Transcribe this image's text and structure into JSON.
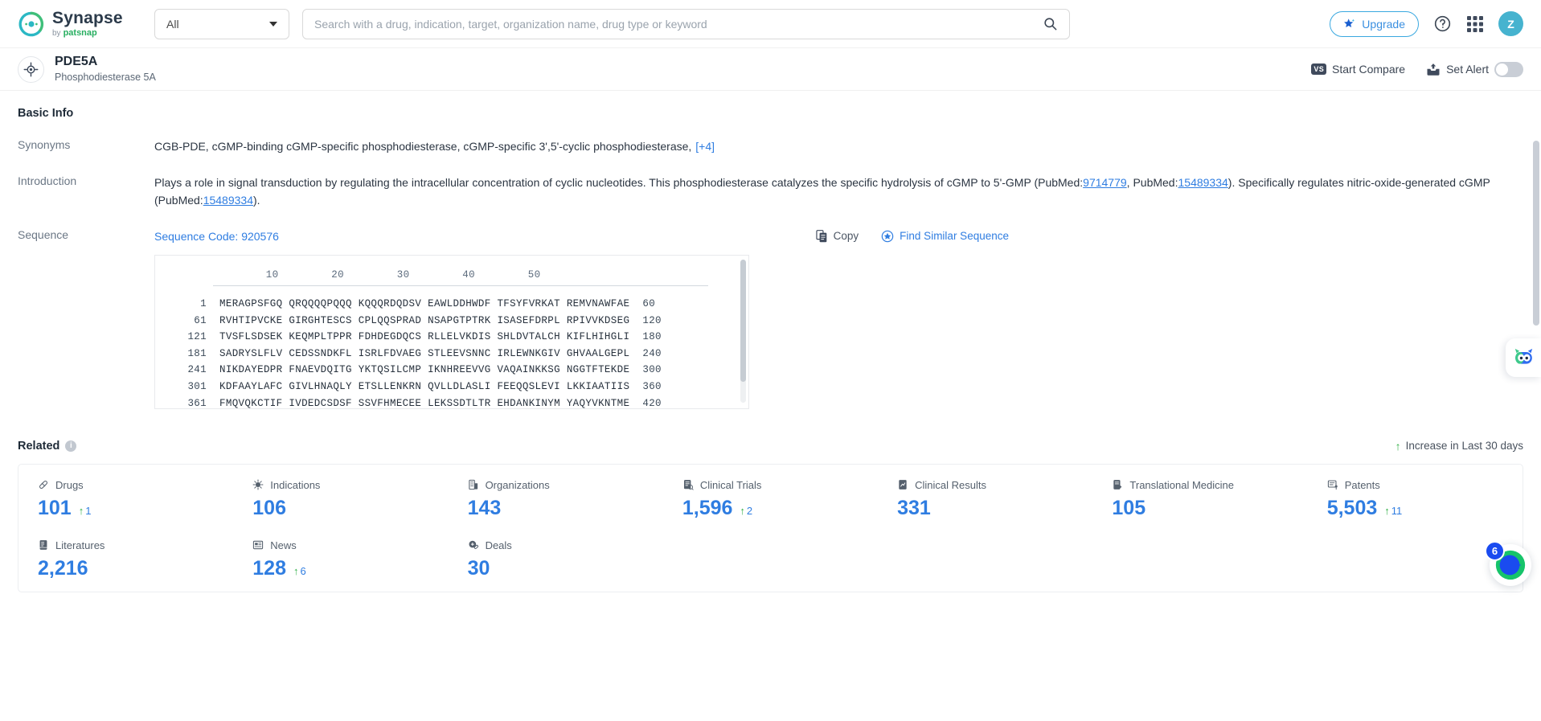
{
  "header": {
    "logo_name": "Synapse",
    "logo_by": "by",
    "logo_brand": "patsnap",
    "scope_value": "All",
    "search_placeholder": "Search with a drug, indication, target, organization name, drug type or keyword",
    "search_value": "",
    "upgrade_label": "Upgrade",
    "avatar_initial": "Z"
  },
  "title_bar": {
    "name": "PDE5A",
    "full_name": "Phosphodiesterase 5A",
    "start_compare_label": "Start Compare",
    "compare_badge": "VS",
    "set_alert_label": "Set Alert",
    "alert_enabled": false
  },
  "basic_info": {
    "heading": "Basic Info",
    "synonyms_label": "Synonyms",
    "synonyms_text": "CGB-PDE,  cGMP-binding cGMP-specific phosphodiesterase,  cGMP-specific 3',5'-cyclic phosphodiesterase,",
    "synonyms_more": "[+4]",
    "introduction_label": "Introduction",
    "intro_part1": "Plays a role in signal transduction by regulating the intracellular concentration of cyclic nucleotides. This phosphodiesterase catalyzes the specific hydrolysis of cGMP to 5'-GMP (PubMed:",
    "intro_link1": "9714779",
    "intro_part2": ", PubMed:",
    "intro_link2": "15489334",
    "intro_part3": "). Specifically regulates nitric-oxide-generated cGMP (PubMed:",
    "intro_link3": "15489334",
    "intro_part4": ")."
  },
  "sequence": {
    "label": "Sequence",
    "code_label": "Sequence Code: 920576",
    "copy_label": "Copy",
    "find_similar_label": "Find Similar Sequence",
    "ruler": [
      "10",
      "20",
      "30",
      "40",
      "50"
    ],
    "rows": [
      {
        "start": "1",
        "chunks": "MERAGPSFGQ QRQQQQPQQQ KQQQRDQDSV EAWLDDHWDF TFSYFVRKAT REMVNAWFAE",
        "end": "60"
      },
      {
        "start": "61",
        "chunks": "RVHTIPVCKE GIRGHTESCS CPLQQSPRAD NSAPGTPTRK ISASEFDRPL RPIVVKDSEG",
        "end": "120"
      },
      {
        "start": "121",
        "chunks": "TVSFLSDSEK KEQMPLTPPR FDHDEGDQCS RLLELVKDIS SHLDVTALCH KIFLHIHGLI",
        "end": "180"
      },
      {
        "start": "181",
        "chunks": "SADRYSLFLV CEDSSNDKFL ISRLFDVAEG STLEEVSNNC IRLEWNKGIV GHVAALGEPL",
        "end": "240"
      },
      {
        "start": "241",
        "chunks": "NIKDAYEDPR FNAEVDQITG YKTQSILCMP IKNHREEVVG VAQAINKKSG NGGTFTEKDE",
        "end": "300"
      },
      {
        "start": "301",
        "chunks": "KDFAAYLAFC GIVLHNAQLY ETSLLENKRN QVLLDLASLI FEEQQSLEVI LKKIAATIIS",
        "end": "360"
      },
      {
        "start": "361",
        "chunks": "FMQVQKCTIF IVDEDCSDSF SSVFHMECEE LEKSSDTLTR EHDANKINYM YAQYVKNTME",
        "end": "420"
      }
    ]
  },
  "related": {
    "heading": "Related",
    "info_glyph": "i",
    "increase_note": "Increase in Last 30 days",
    "cards": [
      {
        "icon": "pill-icon",
        "label": "Drugs",
        "value": "101",
        "delta": "1"
      },
      {
        "icon": "virus-icon",
        "label": "Indications",
        "value": "106",
        "delta": ""
      },
      {
        "icon": "building-icon",
        "label": "Organizations",
        "value": "143",
        "delta": ""
      },
      {
        "icon": "clinical-trial-icon",
        "label": "Clinical Trials",
        "value": "1,596",
        "delta": "2"
      },
      {
        "icon": "clinical-result-icon",
        "label": "Clinical Results",
        "value": "331",
        "delta": ""
      },
      {
        "icon": "translational-medicine-icon",
        "label": "Translational Medicine",
        "value": "105",
        "delta": ""
      },
      {
        "icon": "patent-icon",
        "label": "Patents",
        "value": "5,503",
        "delta": "11"
      },
      {
        "icon": "literature-icon",
        "label": "Literatures",
        "value": "2,216",
        "delta": ""
      },
      {
        "icon": "news-icon",
        "label": "News",
        "value": "128",
        "delta": "6"
      },
      {
        "icon": "deal-icon",
        "label": "Deals",
        "value": "30",
        "delta": ""
      }
    ]
  },
  "floating": {
    "chat_badge": "6"
  },
  "colors": {
    "accent_blue": "#2f7de1",
    "green": "#35b14a",
    "avatar": "#46b3cf"
  }
}
